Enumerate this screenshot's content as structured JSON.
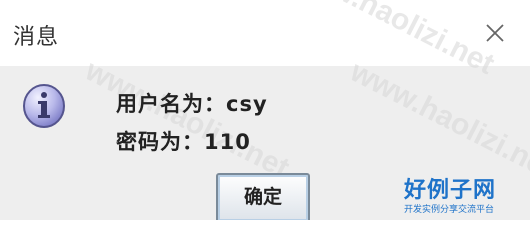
{
  "window": {
    "title": "消息",
    "close_icon": "close-icon"
  },
  "message": {
    "icon": "info-icon",
    "line1": "用户名为：csy",
    "line2": "密码为：110"
  },
  "buttons": {
    "ok_label": "确定"
  },
  "watermark": {
    "text": "www.haolizi.net"
  },
  "logo": {
    "title": "好例子网",
    "subtitle": "开发实例分享交流平台"
  }
}
